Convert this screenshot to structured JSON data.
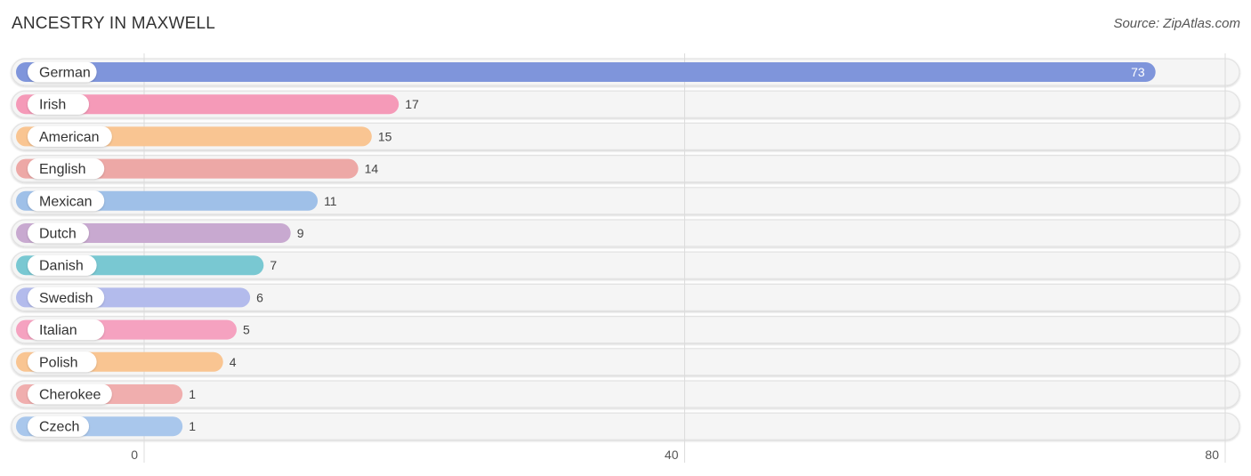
{
  "header": {
    "title": "ANCESTRY IN MAXWELL",
    "source": "Source: ZipAtlas.com"
  },
  "chart_data": {
    "type": "bar",
    "orientation": "horizontal",
    "title": "ANCESTRY IN MAXWELL",
    "source": "Source: ZipAtlas.com",
    "xlabel": "",
    "ylabel": "",
    "xlim": [
      0,
      80
    ],
    "xticks": [
      0,
      40,
      80
    ],
    "grid": true,
    "categories": [
      "German",
      "Irish",
      "American",
      "English",
      "Mexican",
      "Dutch",
      "Danish",
      "Swedish",
      "Italian",
      "Polish",
      "Cherokee",
      "Czech"
    ],
    "values": [
      73,
      17,
      15,
      14,
      11,
      9,
      7,
      6,
      5,
      4,
      1,
      1
    ],
    "colors": [
      "#7f95db",
      "#f59ab8",
      "#f9c592",
      "#eda8a6",
      "#9fc0e8",
      "#c8a9d0",
      "#79c8d2",
      "#b3bbec",
      "#f5a2c0",
      "#f9c592",
      "#f0aeae",
      "#a9c7ec"
    ]
  }
}
